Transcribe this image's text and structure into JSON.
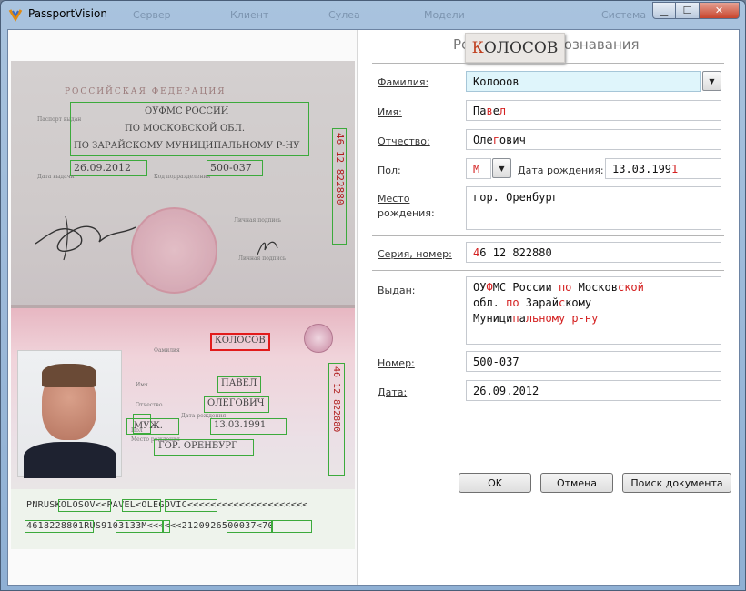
{
  "window": {
    "title": "PassportVision",
    "ghost_menu": [
      "Сервер",
      "Клиент",
      "Сулеа",
      "Модели",
      "Система"
    ]
  },
  "scan": {
    "country_header": "РОССИЙСКАЯ  ФЕДЕРАЦИЯ",
    "issued_by_label": "Паспорт выдан",
    "issued_by_lines": [
      "ОУФМС РОССИИ",
      "ПО МОСКОВСКОЙ ОБЛ.",
      "ПО ЗАРАЙСКОМУ МУНИЦИПАЛЬНОМУ Р-НУ"
    ],
    "issue_date": "26.09.2012",
    "date_label": "Дата выдачи",
    "code_label": "Код подразделения",
    "dept_code": "500-037",
    "personal_sig_label": "Личная подпись",
    "surname": "КОЛОСОВ",
    "surname_label": "Фамилия",
    "name": "ПАВЕЛ",
    "name_label": "Имя",
    "patronymic": "ОЛЕГОВИЧ",
    "patronymic_label": "Отчество",
    "sex": "МУЖ.",
    "sex_label": "Пол",
    "birth_date": "13.03.1991",
    "birth_label": "Дата рождения",
    "birthplace": "ГОР. ОРЕНБУРГ",
    "birthplace_label": "Место рождения",
    "vertical_number": "46  12  822880",
    "mrz_line1": "PNRUSKOLOSOV<<PAVEL<OLEGOVIC<<<<<<<<<<<<<<<<<<<<<",
    "mrz_line2": "4618228801RUS9103133M<<<<<<2120926500037<70"
  },
  "form": {
    "title": "Результат распознавания",
    "zoom_first": "К",
    "zoom_rest": "ОЛОСОВ",
    "surname_label": "Фамилия:",
    "surname_value": "Колооов",
    "name_label": "Имя:",
    "name_value_black": "Па",
    "name_value_red1": "в",
    "name_value_mid": "е",
    "name_value_red2": "л",
    "patronymic_label": "Отчество:",
    "patronymic_value_a": "Оле",
    "patronymic_value_b": "г",
    "patronymic_value_c": "ович",
    "sex_label": "Пол:",
    "sex_value": "М",
    "birth_label": "Дата рождения:",
    "birth_value_a": "13.03.199",
    "birth_value_b": "1",
    "birthplace_label_1": "Место",
    "birthplace_label_2": "рождения:",
    "birthplace_value": "гор. Оренбург",
    "series_label": "Серия, номер:",
    "series_value_a": "4",
    "series_value_b": "6 12 822880",
    "issued_label": "Выдан:",
    "issued_line1_a": "ОУ",
    "issued_line1_b": "Ф",
    "issued_line1_c": "МС России ",
    "issued_line1_d": "по",
    "issued_line1_e": " Москов",
    "issued_line1_f": "ской",
    "issued_line2_a": "обл. ",
    "issued_line2_b": "по",
    "issued_line2_c": " Зарай",
    "issued_line2_d": "с",
    "issued_line2_e": "кому",
    "issued_line3_a": "Муници",
    "issued_line3_b": "п",
    "issued_line3_c": "а",
    "issued_line3_d": "льному р-ну",
    "number_label": "Номер:",
    "number_value": "500-037",
    "date_label": "Дата:",
    "date_value": "26.09.2012",
    "ok": "OK",
    "cancel": "Отмена",
    "search": "Поиск документа"
  },
  "colors": {
    "accent_red": "#d42020",
    "box_green": "#3caa3c",
    "field_highlight": "#dff5fb"
  }
}
